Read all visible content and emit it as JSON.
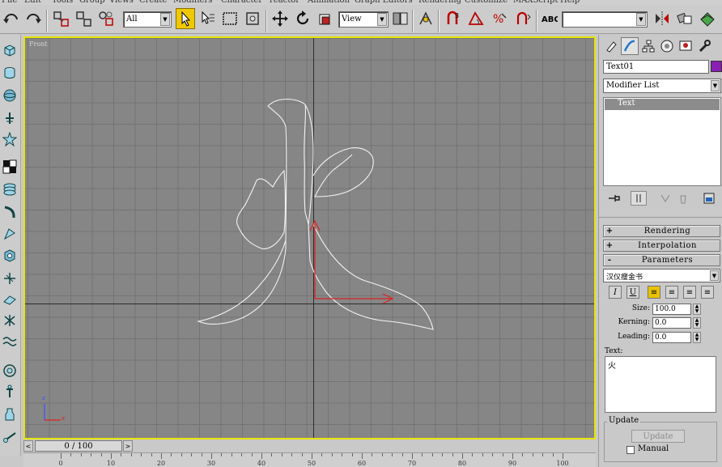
{
  "menubar": {
    "items": [
      "File",
      "Edit",
      "Tools",
      "Group",
      "Views",
      "Create",
      "Modifiers",
      "Character",
      "reactor",
      "Animation",
      "Graph Editors",
      "Rendering",
      "Customize",
      "MAXScript",
      "Help"
    ]
  },
  "toolbar": {
    "selection_filter": "All",
    "reference_coord": "View",
    "named_selection": ""
  },
  "viewport": {
    "label": "Front",
    "border_color": "#e6e300",
    "axis_labels": {
      "x": "x",
      "z": "z"
    }
  },
  "command_panel": {
    "object_name": "Text01",
    "object_color": "#8a1fb3",
    "modifier_list_label": "Modifier List",
    "stack_items": [
      "Text"
    ],
    "rollouts": [
      {
        "sign": "+",
        "label": "Rendering"
      },
      {
        "sign": "+",
        "label": "Interpolation"
      },
      {
        "sign": "-",
        "label": "Parameters"
      }
    ],
    "font": "汉仪瘦金书",
    "format_buttons": [
      "I",
      "U",
      "≡",
      "≡",
      "≡",
      "≡"
    ],
    "size_label": "Size:",
    "size_value": "100.0",
    "kerning_label": "Kerning:",
    "kerning_value": "0.0",
    "leading_label": "Leading:",
    "leading_value": "0.0",
    "text_label": "Text:",
    "text_value": "火",
    "update_group_label": "Update",
    "update_button": "Update",
    "manual_label": "Manual"
  },
  "time_slider": {
    "frame_display": "0 / 100"
  },
  "track_bar": {
    "tick_labels": [
      "0",
      "10",
      "20",
      "30",
      "40",
      "50",
      "60",
      "70",
      "80",
      "90",
      "100"
    ]
  }
}
